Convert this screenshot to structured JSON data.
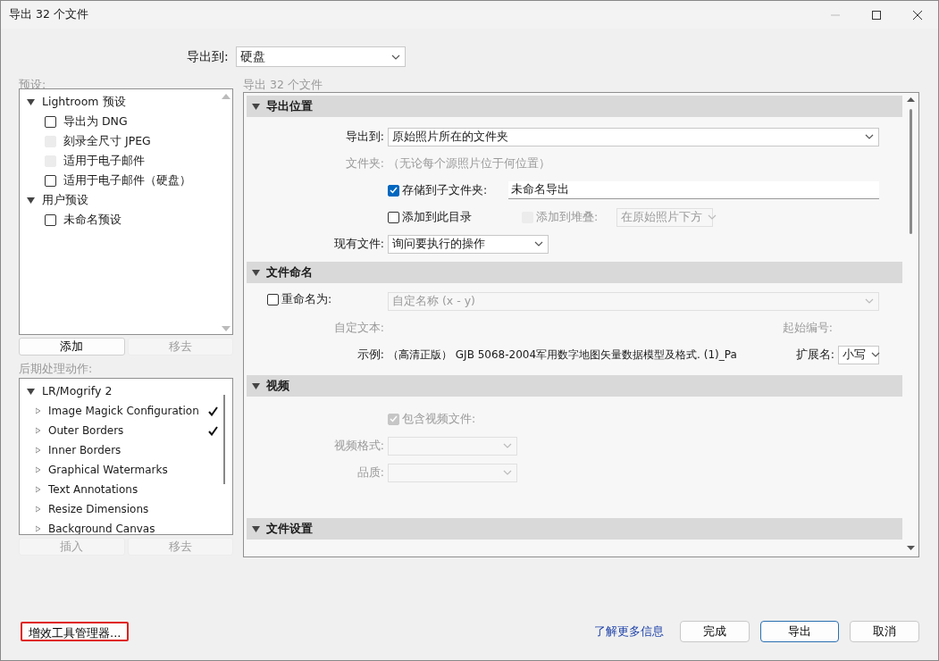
{
  "window": {
    "title": "导出 32 个文件"
  },
  "export_to": {
    "label": "导出到:",
    "value": "硬盘"
  },
  "presets": {
    "label": "预设:",
    "groups": [
      {
        "label": "Lightroom 预设",
        "expanded": true,
        "children": [
          {
            "label": "导出为 DNG",
            "checked": false,
            "disabled": false
          },
          {
            "label": "刻录全尺寸 JPEG",
            "checked": false,
            "disabled": true
          },
          {
            "label": "适用于电子邮件",
            "checked": false,
            "disabled": true
          },
          {
            "label": "适用于电子邮件（硬盘）",
            "checked": false,
            "disabled": false
          }
        ]
      },
      {
        "label": "用户预设",
        "expanded": true,
        "children": [
          {
            "label": "未命名预设",
            "checked": false,
            "disabled": false
          }
        ]
      }
    ]
  },
  "preset_buttons": [
    {
      "label": "添加",
      "disabled": false
    },
    {
      "label": "移去",
      "disabled": true
    }
  ],
  "actions": {
    "label": "后期处理动作:",
    "groups": [
      {
        "label": "LR/Mogrify 2",
        "expanded": true,
        "children": [
          {
            "label": "Image Magick Configuration",
            "checked": true
          },
          {
            "label": "Outer Borders",
            "checked": true
          },
          {
            "label": "Inner Borders",
            "checked": false
          },
          {
            "label": "Graphical Watermarks",
            "checked": false
          },
          {
            "label": "Text Annotations",
            "checked": false
          },
          {
            "label": "Resize Dimensions",
            "checked": false
          },
          {
            "label": "Background Canvas",
            "checked": false
          }
        ]
      }
    ]
  },
  "action_buttons": [
    {
      "label": "插入",
      "disabled": true
    },
    {
      "label": "移去",
      "disabled": true
    }
  ],
  "settings": {
    "label": "导出 32 个文件",
    "sections": [
      {
        "title": "导出位置",
        "expanded": true,
        "rows": [
          {
            "label": "导出到:",
            "label_disabled": false,
            "items": [
              {
                "kind": "select",
                "value": "原始照片所在的文件夹",
                "wide": true,
                "disabled": false
              }
            ]
          },
          {
            "label": "文件夹:",
            "label_disabled": true,
            "items": [
              {
                "kind": "text",
                "text": "（无论每个源照片位于何位置）",
                "disabled": true
              }
            ]
          },
          {
            "items": [
              {
                "kind": "checkbox",
                "text": "存储到子文件夹:",
                "checked": true,
                "disabled": false
              },
              {
                "kind": "input",
                "value": "未命名导出"
              }
            ]
          },
          {
            "items": [
              {
                "kind": "checkbox",
                "text": "添加到此目录",
                "checked": false,
                "disabled": false
              },
              {
                "kind": "checkbox",
                "text": "添加到堆叠:",
                "checked": false,
                "disabled": true
              },
              {
                "kind": "select",
                "value": "在原始照片下方",
                "wide": false,
                "disabled": true
              }
            ]
          },
          {
            "label": "现有文件:",
            "label_disabled": false,
            "items": [
              {
                "kind": "select",
                "value": "询问要执行的操作",
                "wide": false,
                "disabled": false
              }
            ]
          }
        ]
      },
      {
        "title": "文件命名",
        "expanded": true,
        "rows": [
          {
            "lead": {
              "text": "重命名为:",
              "checked": false
            },
            "items": [
              {
                "kind": "select",
                "value": "自定名称 (x - y)",
                "wide": true,
                "disabled": true
              }
            ]
          },
          {
            "label": "自定文本:",
            "label_disabled": true,
            "items": [
              {
                "kind": "side-label",
                "text": "起始编号:",
                "disabled": true
              }
            ]
          },
          {
            "label": "示例:",
            "label_disabled": false,
            "items": [
              {
                "kind": "text",
                "text": "（高清正版） GJB 5068-2004军用数字地图矢量数据模型及格式. (1)_Pa",
                "disabled": false
              },
              {
                "kind": "side-label",
                "text": "扩展名:",
                "disabled": false
              },
              {
                "kind": "select",
                "value": "小写",
                "wide": false,
                "disabled": false
              }
            ]
          }
        ]
      },
      {
        "title": "视频",
        "expanded": true,
        "rows": [
          {
            "items": [
              {
                "kind": "checkbox",
                "text": "包含视频文件:",
                "checked": true,
                "disabled": true
              }
            ]
          },
          {
            "label": "视频格式:",
            "label_disabled": true,
            "items": [
              {
                "kind": "select",
                "wide": false,
                "disabled": true
              }
            ]
          },
          {
            "label": "品质:",
            "label_disabled": true,
            "items": [
              {
                "kind": "select",
                "wide": false,
                "disabled": true
              }
            ]
          }
        ]
      },
      {
        "title": "文件设置",
        "expanded": true
      }
    ]
  },
  "footer": {
    "plugin_button": {
      "label": "增效工具管理器...",
      "highlighted": true
    },
    "link": "了解更多信息",
    "buttons": [
      {
        "label": "完成",
        "default": false
      },
      {
        "label": "导出",
        "default": true
      },
      {
        "label": "取消",
        "default": false
      }
    ]
  }
}
